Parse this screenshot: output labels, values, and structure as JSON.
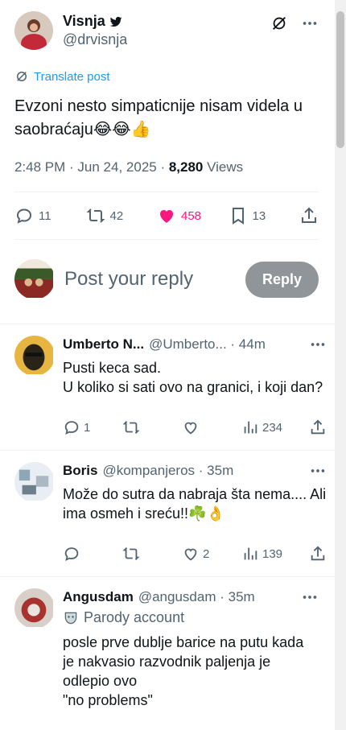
{
  "post": {
    "author_name": "Visnja",
    "author_handle": "@drvisnja",
    "translate_label": "Translate post",
    "text": "Evzoni nesto simpaticnije nisam videla u saobraćaju😂😂👍",
    "time": "2:48 PM",
    "date": "Jun 24, 2025",
    "views_count": "8,280",
    "views_label": "Views",
    "replies": "11",
    "reposts": "42",
    "likes": "458",
    "bookmarks": "13",
    "colors": {
      "like": "#f91880",
      "link": "#1d9bf0"
    }
  },
  "reply_box": {
    "placeholder": "Post your reply",
    "button": "Reply"
  },
  "replies": [
    {
      "name": "Umberto N...",
      "handle": "@Umberto...",
      "time": "44m",
      "text_1": "Pusti keca sad.",
      "text_2": "U koliko si sati ovo na granici, i koji dan?",
      "replies": "1",
      "reposts": "",
      "likes": "",
      "views": "234"
    },
    {
      "name": "Boris",
      "handle": "@kompanjeros",
      "time": "35m",
      "text": "Može do sutra da nabraja šta nema.... Ali ima osmeh i sreću!!☘️👌",
      "replies": "",
      "reposts": "",
      "likes": "2",
      "views": "139"
    },
    {
      "name": "Angusdam",
      "handle": "@angusdam",
      "time": "35m",
      "badge": "Parody account",
      "text_1": "posle prve dublje barice na putu kada je nakvasio razvodnik paljenja je odlepio ovo",
      "text_2": "\"no problems\""
    }
  ]
}
